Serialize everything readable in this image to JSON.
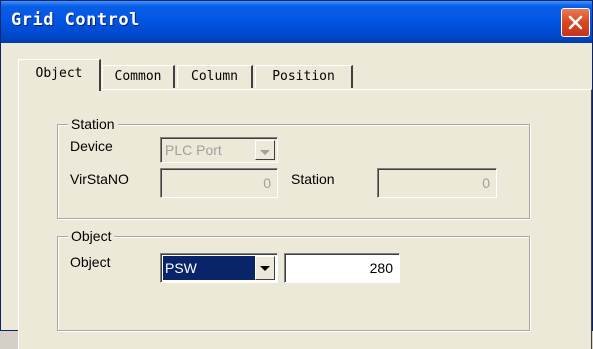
{
  "window": {
    "title": "Grid Control"
  },
  "tabs": [
    {
      "label": "Object"
    },
    {
      "label": "Common"
    },
    {
      "label": "Column"
    },
    {
      "label": "Position"
    }
  ],
  "station_group": {
    "legend": "Station",
    "device_label": "Device",
    "device_value": "PLC Port",
    "virstano_label": "VirStaNO",
    "virstano_value": "0",
    "station_label": "Station",
    "station_value": "0"
  },
  "object_group": {
    "legend": "Object",
    "object_label": "Object",
    "object_value": "PSW",
    "address_value": "280"
  },
  "icons": {
    "close": "close-icon",
    "dropdown": "chevron-down-icon"
  },
  "colors": {
    "titlebar": "#0054e3",
    "close_button": "#d9471f",
    "selection": "#0a246a",
    "dialog_bg": "#ece9d8"
  }
}
